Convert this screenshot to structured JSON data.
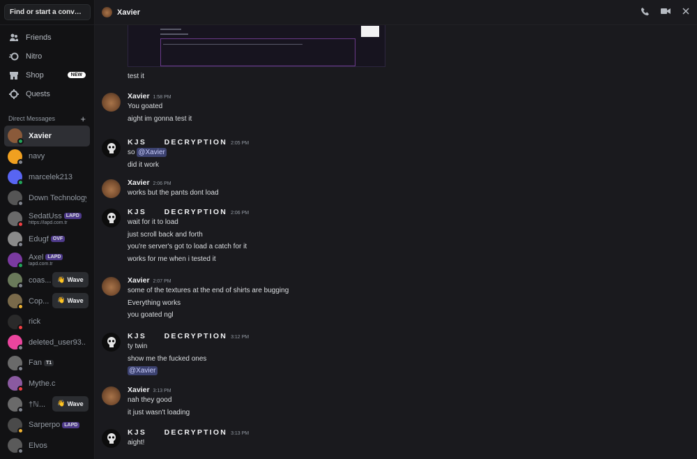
{
  "sidebar": {
    "search_label": "Find or start a conversation",
    "nav": [
      {
        "label": "Friends",
        "icon": "friends-icon"
      },
      {
        "label": "Nitro",
        "icon": "nitro-icon"
      },
      {
        "label": "Shop",
        "icon": "shop-icon",
        "badge": "NEW"
      },
      {
        "label": "Quests",
        "icon": "quests-icon"
      }
    ],
    "dm_header": "Direct Messages",
    "dms": [
      {
        "name": "Xavier",
        "status": "online",
        "color": "#8a5a3a",
        "active": true
      },
      {
        "name": "navy",
        "status": "offline",
        "color": "#f0a020"
      },
      {
        "name": "marcelek213",
        "status": "online",
        "color": "#5865f2"
      },
      {
        "name": "Down Technology",
        "status": "offline",
        "color": "#555555"
      },
      {
        "name": "SedatUss",
        "status": "dnd",
        "color": "#6a6a6a",
        "tag": "LAPD",
        "sub": "https://lapd.com.tr"
      },
      {
        "name": "Edugf",
        "status": "offline",
        "color": "#8a8a8a",
        "tag": "OVF"
      },
      {
        "name": "Axel",
        "status": "online",
        "color": "#7a3aa0",
        "tag": "LAPD",
        "sub": "lapd.com.tr"
      },
      {
        "name": "coas...",
        "status": "offline",
        "color": "#6a7a5a",
        "wave": "Wave"
      },
      {
        "name": "Cop...",
        "status": "idle",
        "color": "#7a6a4a",
        "wave": "Wave"
      },
      {
        "name": "rick",
        "status": "dnd",
        "color": "#2a2a2a"
      },
      {
        "name": "deleted_user93...",
        "status": "offline",
        "color": "#eb459e"
      },
      {
        "name": "Fan",
        "status": "offline",
        "color": "#6a6a6a",
        "tag": "T1"
      },
      {
        "name": "Mythe.c",
        "status": "dnd",
        "color": "#8a5aa0"
      },
      {
        "name": "†ℕ...",
        "status": "offline",
        "color": "#6a6a6a",
        "wave": "Wave"
      },
      {
        "name": "Sarperpo",
        "status": "idle",
        "color": "#4a4a4a",
        "tag": "LAPD"
      },
      {
        "name": "Elvos",
        "status": "offline",
        "color": "#5a5a5a"
      }
    ]
  },
  "header": {
    "title": "Xavier"
  },
  "messages": {
    "standalone": "test it",
    "groups": [
      {
        "author": "Xavier",
        "time": "1:58 PM",
        "avatar": "bear",
        "lines": [
          "You goated",
          "aight im gonna test it"
        ]
      },
      {
        "author": "KJS     DECRYPTION",
        "time": "2:05 PM",
        "avatar": "skull",
        "spaced": true,
        "lines": [
          "so @Xavier",
          "did it work"
        ]
      },
      {
        "author": "Xavier",
        "time": "2:06 PM",
        "avatar": "bear",
        "lines": [
          "works but the pants dont load"
        ]
      },
      {
        "author": "KJS     DECRYPTION",
        "time": "2:06 PM",
        "avatar": "skull",
        "spaced": true,
        "lines": [
          "wait for it to load",
          "just scroll back and forth",
          "you're server's got to load a catch for it",
          "works for me when i tested it"
        ]
      },
      {
        "author": "Xavier",
        "time": "2:07 PM",
        "avatar": "bear",
        "lines": [
          "some of the textures at the end of shirts are bugging",
          "Everything works",
          "you goated ngl"
        ]
      },
      {
        "author": "KJS     DECRYPTION",
        "time": "3:12 PM",
        "avatar": "skull",
        "spaced": true,
        "lines": [
          "ty twin",
          "show me the fucked ones",
          "@Xavier"
        ]
      },
      {
        "author": "Xavier",
        "time": "3:13 PM",
        "avatar": "bear",
        "lines": [
          "nah they good",
          "it just wasn't loading"
        ]
      },
      {
        "author": "KJS     DECRYPTION",
        "time": "3:13 PM",
        "avatar": "skull",
        "spaced": true,
        "lines": [
          "aight!"
        ]
      }
    ]
  }
}
